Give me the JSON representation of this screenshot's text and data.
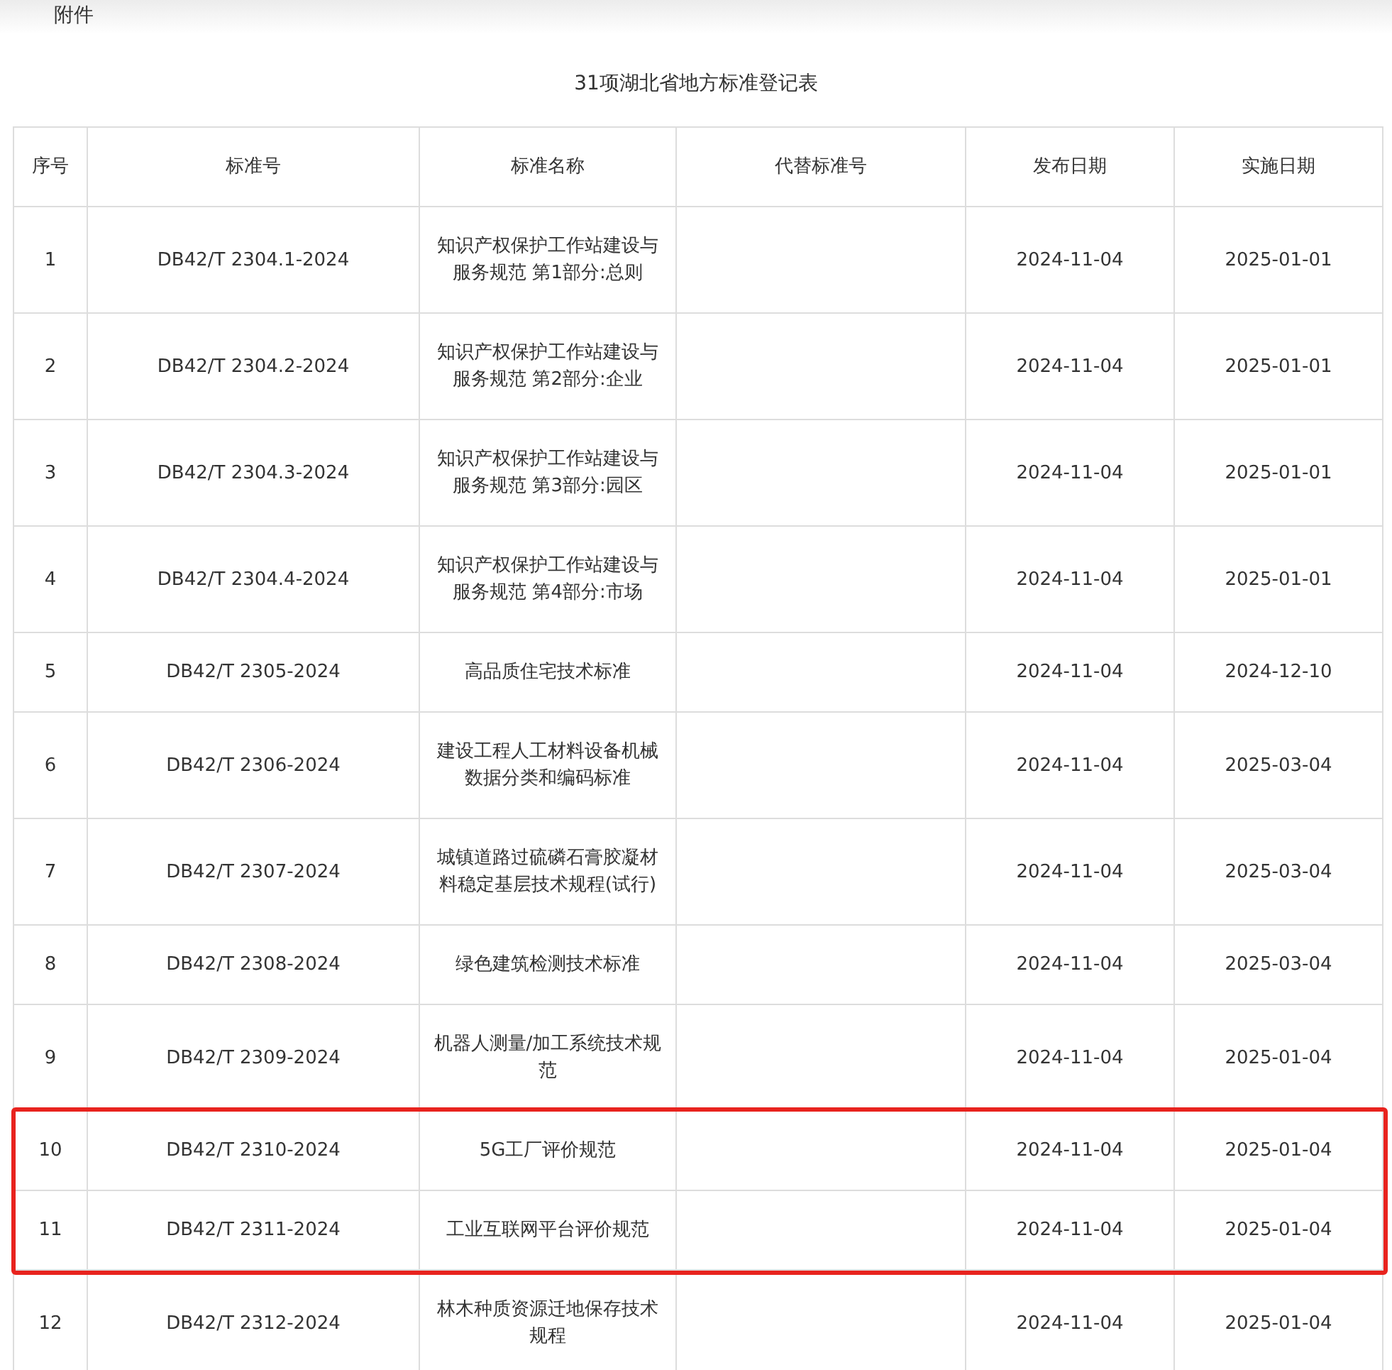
{
  "attachment_label": "附件",
  "title": "31项湖北省地方标准登记表",
  "table": {
    "columns": [
      "序号",
      "标准号",
      "标准名称",
      "代替标准号",
      "发布日期",
      "实施日期"
    ],
    "rows": [
      {
        "cells": [
          "1",
          "DB42/T 2304.1-2024",
          "知识产权保护工作站建设与服务规范 第1部分:总则",
          "",
          "2024-11-04",
          "2025-01-01"
        ],
        "highlighted": false
      },
      {
        "cells": [
          "2",
          "DB42/T 2304.2-2024",
          "知识产权保护工作站建设与服务规范 第2部分:企业",
          "",
          "2024-11-04",
          "2025-01-01"
        ],
        "highlighted": false
      },
      {
        "cells": [
          "3",
          "DB42/T 2304.3-2024",
          "知识产权保护工作站建设与服务规范 第3部分:园区",
          "",
          "2024-11-04",
          "2025-01-01"
        ],
        "highlighted": false
      },
      {
        "cells": [
          "4",
          "DB42/T 2304.4-2024",
          "知识产权保护工作站建设与服务规范 第4部分:市场",
          "",
          "2024-11-04",
          "2025-01-01"
        ],
        "highlighted": false
      },
      {
        "cells": [
          "5",
          "DB42/T 2305-2024",
          "高品质住宅技术标准",
          "",
          "2024-11-04",
          "2024-12-10"
        ],
        "highlighted": false
      },
      {
        "cells": [
          "6",
          "DB42/T 2306-2024",
          "建设工程人工材料设备机械数据分类和编码标准",
          "",
          "2024-11-04",
          "2025-03-04"
        ],
        "highlighted": false
      },
      {
        "cells": [
          "7",
          "DB42/T 2307-2024",
          "城镇道路过硫磷石膏胶凝材料稳定基层技术规程(试行)",
          "",
          "2024-11-04",
          "2025-03-04"
        ],
        "highlighted": false
      },
      {
        "cells": [
          "8",
          "DB42/T 2308-2024",
          "绿色建筑检测技术标准",
          "",
          "2024-11-04",
          "2025-03-04"
        ],
        "highlighted": false
      },
      {
        "cells": [
          "9",
          "DB42/T 2309-2024",
          "机器人测量/加工系统技术规范",
          "",
          "2024-11-04",
          "2025-01-04"
        ],
        "highlighted": false
      },
      {
        "cells": [
          "10",
          "DB42/T 2310-2024",
          "5G工厂评价规范",
          "",
          "2024-11-04",
          "2025-01-04"
        ],
        "highlighted": true
      },
      {
        "cells": [
          "11",
          "DB42/T 2311-2024",
          "工业互联网平台评价规范",
          "",
          "2024-11-04",
          "2025-01-04"
        ],
        "highlighted": true
      },
      {
        "cells": [
          "12",
          "DB42/T 2312-2024",
          "林木种质资源迁地保存技术规程",
          "",
          "2024-11-04",
          "2025-01-04"
        ],
        "highlighted": false
      }
    ]
  }
}
